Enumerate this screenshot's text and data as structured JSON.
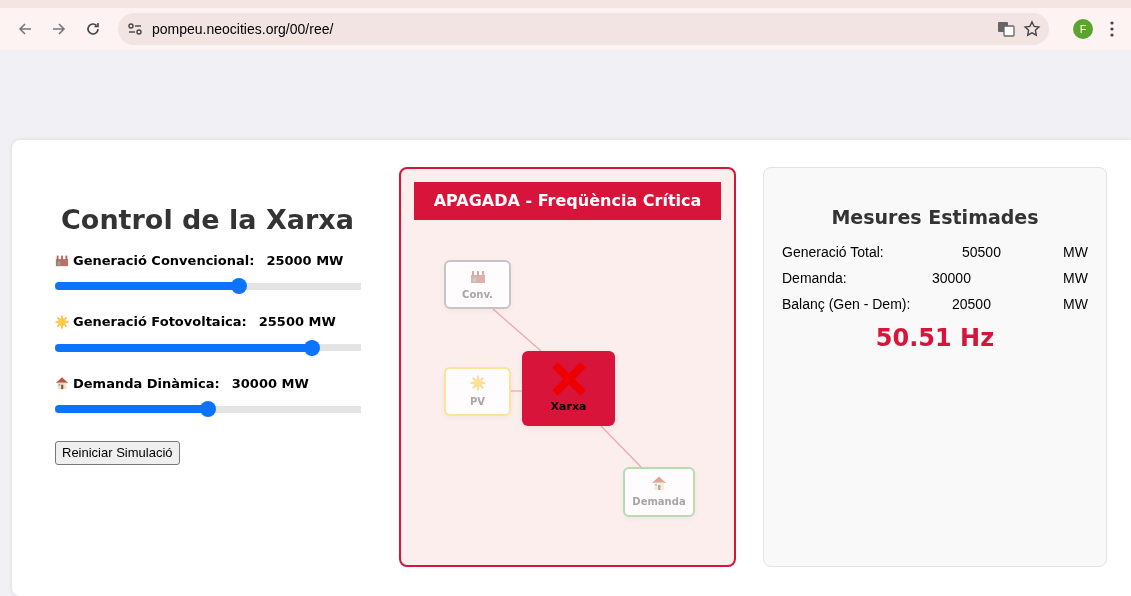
{
  "browser": {
    "url": "pompeu.neocities.org/00/ree/",
    "profile_initial": "F"
  },
  "controls": {
    "title": "Control de la Xarxa",
    "sliders": [
      {
        "kind": "factory",
        "label": "Generació Convencional:",
        "reading": "25000 MW",
        "level": 0.6
      },
      {
        "kind": "sun",
        "label": "Generació Fotovoltaica:",
        "reading": "25500 MW",
        "level": 0.84
      },
      {
        "kind": "house",
        "label": "Demanda Dinàmica:",
        "reading": "30000 MW",
        "level": 0.5
      }
    ],
    "reset_button": "Reiniciar Simulació"
  },
  "diagram": {
    "status": "APAGADA - Freqüència Crítica",
    "alert": true,
    "nodes": [
      {
        "kind": "factory",
        "label": "Conv.",
        "color": "#bdbdbd"
      },
      {
        "kind": "sun",
        "label": "PV",
        "color": "#ffe08a"
      },
      {
        "kind": "grid",
        "label": "Xarxa",
        "failed": true
      },
      {
        "kind": "house",
        "label": "Demanda",
        "color": "#a8d8a8"
      }
    ]
  },
  "measures": {
    "title": "Mesures Estimades",
    "rows": [
      {
        "label": "Generació Total:",
        "value": "50500",
        "unit": "MW"
      },
      {
        "label": "Demanda:",
        "value": "30000",
        "unit": "MW"
      },
      {
        "label": "Balanç (Gen - Dem):",
        "value": "20500",
        "unit": "MW"
      }
    ],
    "frequency": "50.51 Hz",
    "alert": true
  }
}
